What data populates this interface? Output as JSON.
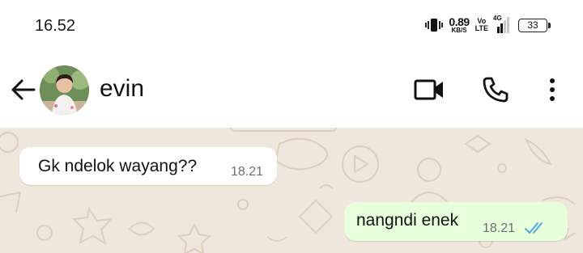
{
  "status_bar": {
    "time": "16.52",
    "net_speed_value": "0.89",
    "net_speed_unit": "KB/S",
    "volte_top": "Vo",
    "volte_bottom": "LTE",
    "network_type": "4G",
    "battery_level": "33",
    "icons": [
      "vibrate-icon",
      "signal-icon",
      "battery-icon"
    ]
  },
  "header": {
    "contact_name": "evin",
    "icons": [
      "back-arrow-icon",
      "video-camera-icon",
      "phone-icon",
      "more-vertical-icon"
    ]
  },
  "messages": [
    {
      "direction": "incoming",
      "text": "Gk ndelok wayang??",
      "time": "18.21"
    },
    {
      "direction": "outgoing",
      "text": "nangndi enek",
      "time": "18.21",
      "status": "read",
      "status_icon": "double-check-icon"
    }
  ],
  "colors": {
    "chat_background": "#efe7dd",
    "incoming_bubble": "#ffffff",
    "outgoing_bubble": "#e7ffdb",
    "read_ticks": "#53a6e8"
  }
}
